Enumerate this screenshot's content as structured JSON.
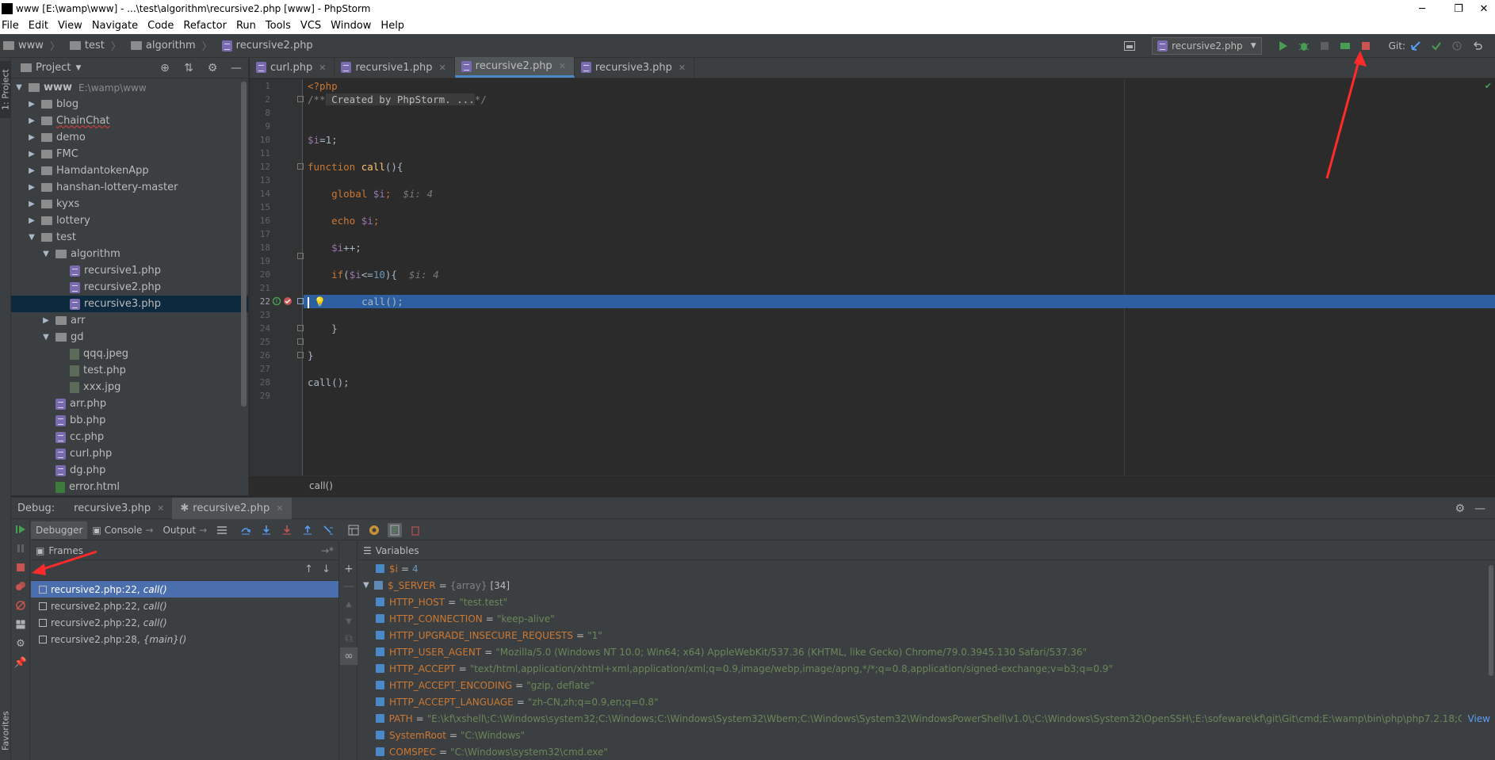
{
  "window": {
    "title": "www [E:\\wamp\\www] - ...\\test\\algorithm\\recursive2.php [www] - PhpStorm",
    "minimize": "─",
    "restore": "❐",
    "close": "✕"
  },
  "menu": [
    "File",
    "Edit",
    "View",
    "Navigate",
    "Code",
    "Refactor",
    "Run",
    "Tools",
    "VCS",
    "Window",
    "Help"
  ],
  "breadcrumb": [
    "www",
    "test",
    "algorithm",
    "recursive2.php"
  ],
  "toolbar": {
    "run_config": "recursive2.php",
    "git_label": "Git:"
  },
  "left_stripe": {
    "project_label": "1: Project",
    "favorites_label": "Favorites"
  },
  "project": {
    "title": "Project",
    "root": {
      "name": "www",
      "path": "E:\\wamp\\www"
    },
    "items": [
      "blog",
      "ChainChat",
      "demo",
      "FMC",
      "HamdantokenApp",
      "hanshan-lottery-master",
      "kyxs",
      "lottery",
      "test",
      "algorithm",
      "recursive1.php",
      "recursive2.php",
      "recursive3.php",
      "arr",
      "gd",
      "qqq.jpeg",
      "test.php",
      "xxx.jpg",
      "arr.php",
      "bb.php",
      "cc.php",
      "curl.php",
      "dg.php",
      "error.html"
    ]
  },
  "editor": {
    "tabs": [
      "curl.php",
      "recursive1.php",
      "recursive2.php",
      "recursive3.php"
    ],
    "active_tab": "recursive2.php",
    "line_numbers": [
      "1",
      "2",
      "8",
      "9",
      "10",
      "11",
      "12",
      "13",
      "14",
      "15",
      "16",
      "17",
      "18",
      "19",
      "20",
      "21",
      "22",
      "23",
      "24",
      "25",
      "26",
      "27",
      "28",
      "29"
    ],
    "code": {
      "l1": "<?php",
      "l2_open": "/**",
      "l2_fold": " Created by PhpStorm. ...",
      "l2_close": "*/",
      "l10_var": "$i",
      "l10_rest": "=1;",
      "l12_kw": "function",
      "l12_fn": "call",
      "l12_rest": "(){",
      "l14_kw": "global",
      "l14_var": "$i",
      "l14_semi": ";",
      "l14_inline": "$i: 4",
      "l16_kw": "echo",
      "l16_var": "$i",
      "l16_semi": ";",
      "l18_var": "$i",
      "l18_rest": "++;",
      "l20_kw": "if",
      "l20_open": "(",
      "l20_var": "$i",
      "l20_op": "<=",
      "l20_num": "10",
      "l20_close": "){",
      "l20_inline": "$i: 4",
      "l22": "call();",
      "l24": "}",
      "l26": "}",
      "l28": "call();"
    },
    "footer_crumb": "call()"
  },
  "debug": {
    "label": "Debug:",
    "sessions": [
      "recursive3.php",
      "recursive2.php"
    ],
    "tabs": {
      "debugger": "Debugger",
      "console": "Console",
      "output": "Output"
    },
    "frames_title": "Frames",
    "frames": [
      {
        "file": "recursive2.php:22,",
        "fn": "call()"
      },
      {
        "file": "recursive2.php:22,",
        "fn": "call()"
      },
      {
        "file": "recursive2.php:22,",
        "fn": "call()"
      },
      {
        "file": "recursive2.php:28,",
        "fn": "{main}()"
      }
    ],
    "variables_title": "Variables",
    "variables": {
      "i_name": "$i",
      "i_value": "4",
      "server_name": "$_SERVER",
      "server_type": "{array}",
      "server_count": "[34]",
      "rows": [
        {
          "key": "HTTP_HOST",
          "value": "\"test.test\""
        },
        {
          "key": "HTTP_CONNECTION",
          "value": "\"keep-alive\""
        },
        {
          "key": "HTTP_UPGRADE_INSECURE_REQUESTS",
          "value": "\"1\""
        },
        {
          "key": "HTTP_USER_AGENT",
          "value": "\"Mozilla/5.0 (Windows NT 10.0; Win64; x64) AppleWebKit/537.36 (KHTML, like Gecko) Chrome/79.0.3945.130 Safari/537.36\""
        },
        {
          "key": "HTTP_ACCEPT",
          "value": "\"text/html,application/xhtml+xml,application/xml;q=0.9,image/webp,image/apng,*/*;q=0.8,application/signed-exchange;v=b3;q=0.9\""
        },
        {
          "key": "HTTP_ACCEPT_ENCODING",
          "value": "\"gzip, deflate\""
        },
        {
          "key": "HTTP_ACCEPT_LANGUAGE",
          "value": "\"zh-CN,zh;q=0.9,en;q=0.8\""
        },
        {
          "key": "PATH",
          "value": "\"E:\\kf\\xshell\\;C:\\Windows\\system32;C:\\Windows;C:\\Windows\\System32\\Wbem;C:\\Windows\\System32\\WindowsPowerShell\\v1.0\\;C:\\Windows\\System32\\OpenSSH\\;E:\\sofeware\\kf\\git\\Git\\cmd;E:\\wamp\\bin\\php\\php7.2.18;C:\\Progr..."
        },
        {
          "key": "SystemRoot",
          "value": "\"C:\\Windows\""
        },
        {
          "key": "COMSPEC",
          "value": "\"C:\\Windows\\system32\\cmd.exe\""
        }
      ],
      "view_link": "View"
    }
  },
  "colors": {
    "background": "#2b2b2b",
    "panel": "#3c3f41",
    "exec_line": "#2d5fa0",
    "frame_selected": "#4b6eaf",
    "annotation": "#ff2a2a"
  }
}
